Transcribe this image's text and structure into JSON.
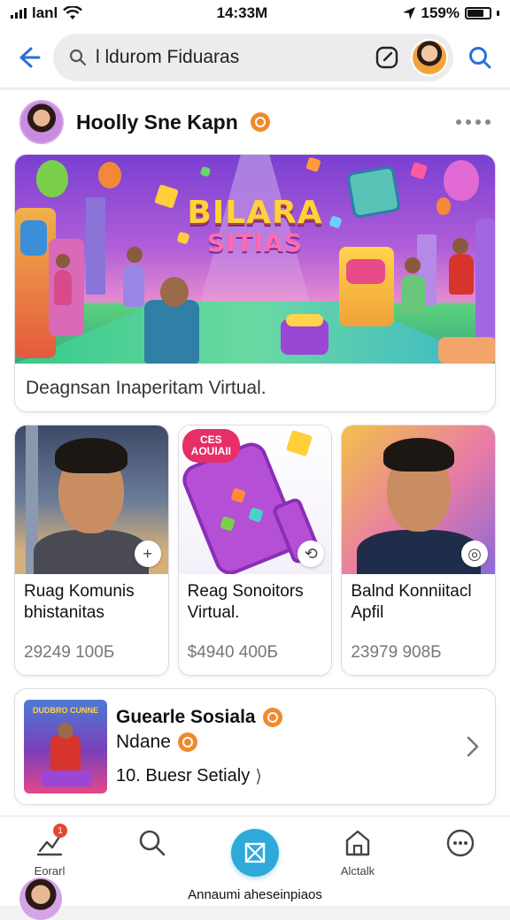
{
  "status_bar": {
    "carrier": "lanl",
    "time": "14:33M",
    "battery": "159%"
  },
  "top_bar": {
    "search_text": "l ldurom Fiduaras"
  },
  "profile": {
    "name": "Hoolly Sne Kapn"
  },
  "hero": {
    "logo_line1": "BILARA",
    "logo_line2": "SITIAS",
    "caption": "Deagnsan Inaperitam Virtual."
  },
  "tiles": [
    {
      "title": "Ruag Komunis bhistanitas",
      "meta": "29249 100Б",
      "fab_glyph": "+"
    },
    {
      "title": "Reag Sonoitors Virtual.",
      "meta": "$4940 400Б",
      "fab_glyph": "⟲",
      "bubble_line1": "CES",
      "bubble_line2": "AOUIAII"
    },
    {
      "title": "Balnd Konniitacl Apfil",
      "meta": "23979 908Б",
      "fab_glyph": "◎"
    }
  ],
  "list_card": {
    "thumb_label": "DUDBRO CUNNE",
    "title": "Guearle Sosiala",
    "subtitle": "Ndane",
    "meta": "10. Buesr Setialy",
    "meta_suffix": "⟩"
  },
  "bottom_nav": {
    "items": [
      {
        "label": "Eorarl",
        "badge": "1"
      },
      {
        "label": ""
      },
      {
        "label": ""
      },
      {
        "label": "Alctalk"
      },
      {
        "label": ""
      }
    ],
    "caption": "Annaumi aheseinpiaos"
  },
  "colors": {
    "accent_blue": "#2a6fd6",
    "center_button": "#2ea9d9",
    "badge_orange": "#f08a2a"
  }
}
